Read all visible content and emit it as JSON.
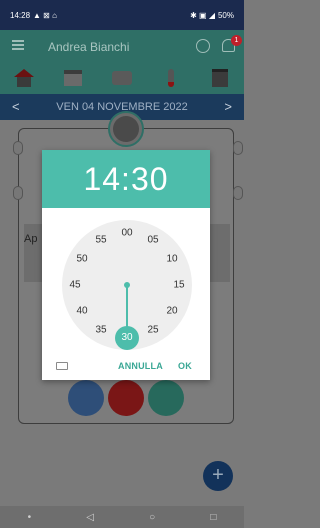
{
  "status_bar": {
    "time": "14:28",
    "icons_left": "▲ ⊠ ⌂",
    "battery": "50%",
    "icons_right": "✱ ▣ ◢"
  },
  "app_bar": {
    "user_name": "Andrea Bianchi",
    "badge": "1"
  },
  "date_bar": {
    "label": "VEN 04 NOVEMBRE 2022",
    "prev": "<",
    "next": ">"
  },
  "background": {
    "text_partial": "Ap"
  },
  "time_picker": {
    "time": "14:30",
    "minutes": [
      "00",
      "05",
      "10",
      "15",
      "20",
      "25",
      "30",
      "35",
      "40",
      "45",
      "50",
      "55"
    ],
    "selected_minute": "30",
    "cancel_label": "ANNULLA",
    "ok_label": "OK"
  },
  "fab_label": "+",
  "nav": {
    "dot": "•",
    "back": "◁",
    "home": "○",
    "recents": "□"
  },
  "colors": {
    "accent": "#4dbdab",
    "app_bar": "#2f6f66",
    "date_bar": "#1b3a5c",
    "status_bar": "#1b2a4e"
  }
}
